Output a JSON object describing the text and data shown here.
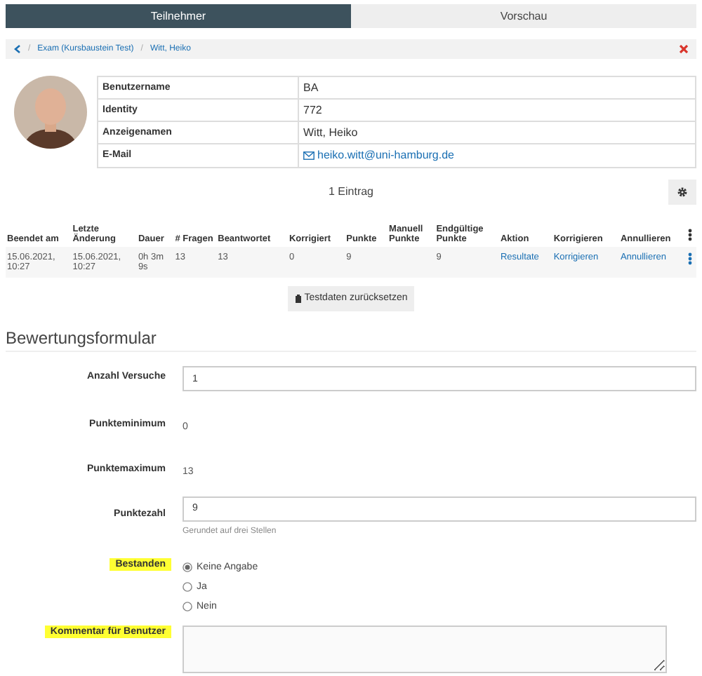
{
  "tabs": [
    {
      "label": "Teilnehmer",
      "selected": true
    },
    {
      "label": "Vorschau",
      "selected": false
    }
  ],
  "breadcrumb": [
    "Exam (Kursbaustein Test)",
    "Witt, Heiko"
  ],
  "breadcrumb_separator": "/",
  "profile": [
    {
      "label": "Benutzername",
      "value": "BA"
    },
    {
      "label": "Identity",
      "value": "772"
    },
    {
      "label": "Anzeigenamen",
      "value": "Witt, Heiko"
    },
    {
      "label": "E-Mail",
      "value": "heiko.witt@uni-hamburg.de",
      "kind": "email"
    }
  ],
  "entry_count": "1 Eintrag",
  "table": {
    "columns": [
      "Beendet am",
      "Letzte Änderung",
      "Dauer",
      "# Fragen",
      "Beantwortet",
      "Korrigiert",
      "Punkte",
      "Manuell Punkte",
      "Endgültige Punkte",
      "Aktion",
      "Korrigieren",
      "Annullieren"
    ],
    "rows": [
      {
        "cells": [
          "15.06.2021, 10:27",
          "15.06.2021, 10:27",
          "0h 3m 9s",
          "13",
          "13",
          "0",
          "9",
          "",
          "9"
        ],
        "links": [
          "Resultate",
          "Korrigieren",
          "Annullieren"
        ]
      }
    ]
  },
  "reset_button": "Testdaten zurücksetzen",
  "form": {
    "title": "Bewertungsformular",
    "fields": [
      {
        "kind": "input",
        "label": "Anzahl Versuche",
        "value": "1",
        "highlighted": false
      },
      {
        "kind": "static",
        "label": "Punkteminimum",
        "value": "0",
        "highlighted": false
      },
      {
        "kind": "static",
        "label": "Punktemaximum",
        "value": "13",
        "highlighted": false
      },
      {
        "kind": "input",
        "label": "Punktezahl",
        "value": "9",
        "hint": "Gerundet auf drei Stellen",
        "highlighted": false
      },
      {
        "kind": "radios",
        "label": "Bestanden",
        "highlighted": true,
        "options": [
          {
            "label": "Keine Angabe",
            "selected": true
          },
          {
            "label": "Ja",
            "selected": false
          },
          {
            "label": "Nein",
            "selected": false
          }
        ]
      },
      {
        "kind": "textarea",
        "label": "Kommentar für Benutzer",
        "highlighted": true
      }
    ]
  }
}
